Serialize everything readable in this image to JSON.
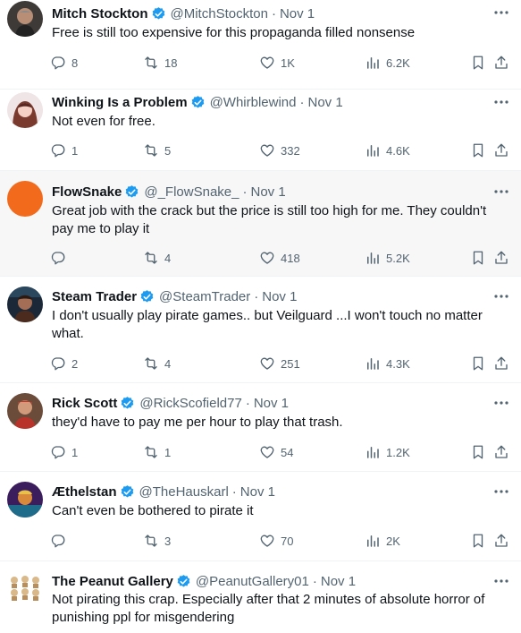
{
  "tweets": [
    {
      "name": "Mitch Stockton",
      "handle": "@MitchStockton",
      "sep": "·",
      "date": "Nov 1",
      "text": "Free is still too expensive for this propaganda filled nonsense",
      "replies": "8",
      "retweets": "18",
      "likes": "1K",
      "views": "6.2K"
    },
    {
      "name": "Winking Is a Problem",
      "handle": "@Whirblewind",
      "sep": "·",
      "date": "Nov 1",
      "text": "Not even for free.",
      "replies": "1",
      "retweets": "5",
      "likes": "332",
      "views": "4.6K"
    },
    {
      "name": "FlowSnake",
      "handle": "@_FlowSnake_",
      "sep": "·",
      "date": "Nov 1",
      "text": "Great job with the crack but the price is still too high for me. They couldn't pay me to play it",
      "replies": "",
      "retweets": "4",
      "likes": "418",
      "views": "5.2K"
    },
    {
      "name": "Steam Trader",
      "handle": "@SteamTrader",
      "sep": "·",
      "date": "Nov 1",
      "text": "I don't usually play pirate games.. but Veilguard ...I won't touch no matter what.",
      "replies": "2",
      "retweets": "4",
      "likes": "251",
      "views": "4.3K"
    },
    {
      "name": "Rick Scott",
      "handle": "@RickScofield77",
      "sep": "·",
      "date": "Nov 1",
      "text": "they'd have to pay me per hour to play that trash.",
      "replies": "1",
      "retweets": "1",
      "likes": "54",
      "views": "1.2K"
    },
    {
      "name": "Æthelstan",
      "handle": "@TheHauskarl",
      "sep": "·",
      "date": "Nov 1",
      "text": "Can't even be bothered to pirate it",
      "replies": "",
      "retweets": "3",
      "likes": "70",
      "views": "2K"
    },
    {
      "name": "The Peanut Gallery",
      "handle": "@PeanutGallery01",
      "sep": "·",
      "date": "Nov 1",
      "text": "Not pirating this crap. Especially after that 2 minutes of absolute horror of punishing ppl for misgendering"
    }
  ],
  "colors": {
    "verified": "#1d9bf0",
    "muted": "#536471",
    "text": "#0f1419",
    "hover_bg": "#f7f7f7",
    "flowsnake_avatar": "#f26b1d"
  },
  "icons": [
    "reply-icon",
    "retweet-icon",
    "like-icon",
    "views-icon",
    "bookmark-icon",
    "share-icon",
    "more-icon",
    "verified-badge-icon"
  ]
}
